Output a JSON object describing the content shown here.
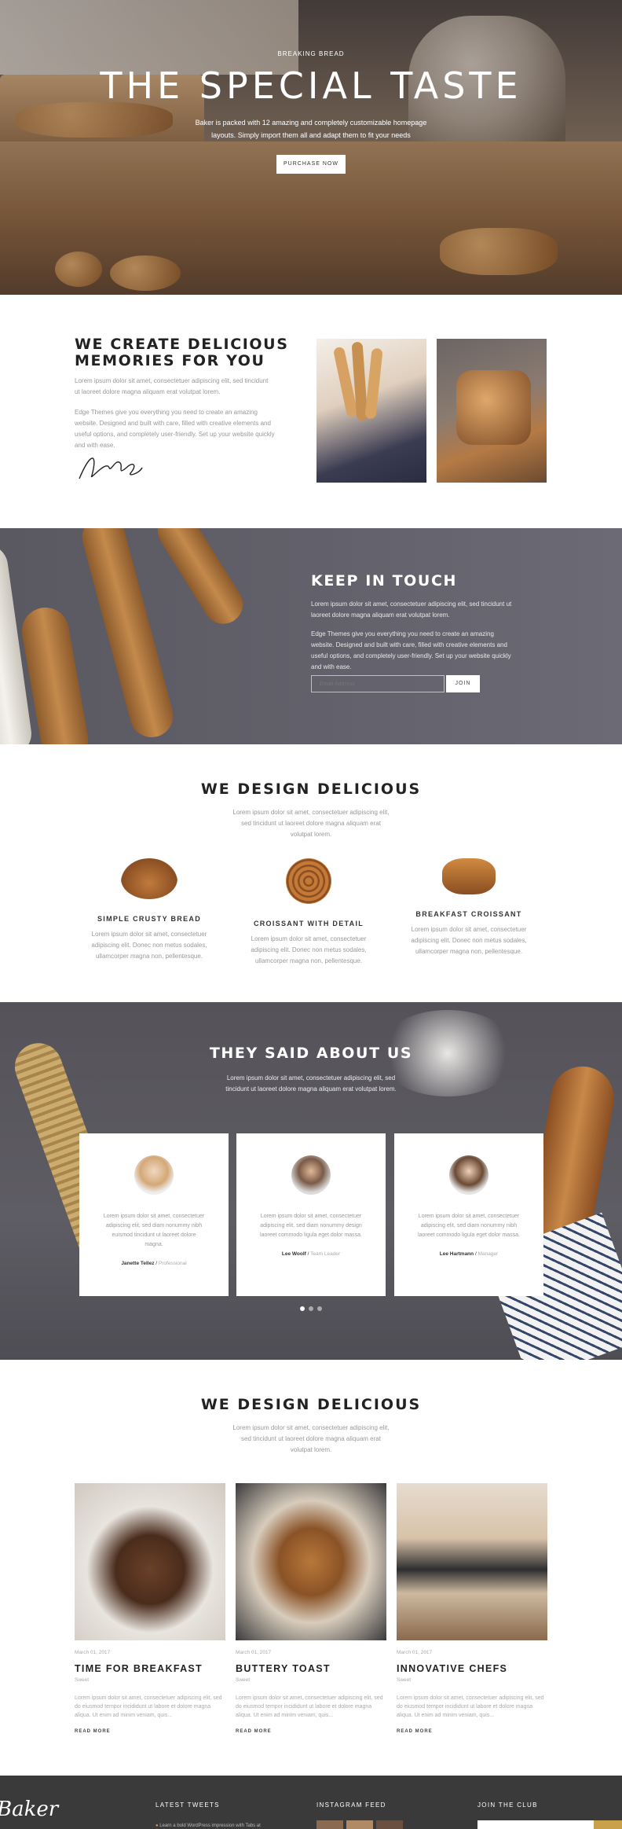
{
  "hero": {
    "eyebrow": "BREAKING BREAD",
    "title": "THE SPECIAL TASTE",
    "subtitle": "Baker is packed with 12 amazing and completely customizable homepage layouts. Simply import them all and adapt them to fit your needs",
    "button": "PURCHASE NOW"
  },
  "about": {
    "title": "WE CREATE DELICIOUS MEMORIES FOR YOU",
    "text1": "Lorem ipsum dolor sit amet, consectetuer adipiscing elit, sed tincidunt ut laoreet dolore magna aliquam erat volutpat lorem.",
    "text2": "Edge Themes give you everything you need to create an amazing website. Designed and built with care, filled with creative elements and useful options, and completely user-friendly. Set up your website quickly and with ease."
  },
  "touch": {
    "title": "KEEP IN TOUCH",
    "text1": "Lorem ipsum dolor sit amet, consectetuer adipiscing elit, sed tincidunt ut laoreet dolore magna aliquam erat volutpat lorem.",
    "text2": "Edge Themes give you everything you need to create an amazing website. Designed and built with care, filled with creative elements and useful options, and completely user-friendly. Set up your website quickly and with ease.",
    "email_placeholder": "Email Address",
    "button": "JOIN"
  },
  "design": {
    "title": "WE DESIGN DELICIOUS",
    "subtitle": "Lorem ipsum dolor sit amet, consectetuer adipiscing elit, sed tincidunt ut laoreet dolore magna aliquam erat volutpat lorem.",
    "features": [
      {
        "title": "SIMPLE CRUSTY BREAD",
        "desc": "Lorem ipsum dolor sit amet, consectetuer adipiscing elit. Donec non metus sodales, ullamcorper magna non, pellentesque.",
        "icon": "croissant-icon",
        "color": "#9a5a2c"
      },
      {
        "title": "CROISSANT WITH DETAIL",
        "desc": "Lorem ipsum dolor sit amet, consectetuer adipiscing elit. Donec non metus sodales, ullamcorper magna non, pellentesque.",
        "icon": "cinnamon-roll-icon",
        "color": "#b06a2e"
      },
      {
        "title": "BREAKFAST CROISSANT",
        "desc": "Lorem ipsum dolor sit amet, consectetuer adipiscing elit. Donec non metus sodales, ullamcorper magna non, pellentesque.",
        "icon": "pastry-icon",
        "color": "#b8742e"
      }
    ]
  },
  "testimonials": {
    "title": "THEY SAID ABOUT US",
    "subtitle": "Lorem ipsum dolor sit amet, consectetuer adipiscing elit, sed tincidunt ut laoreet dolore magna aliquam erat volutpat lorem.",
    "items": [
      {
        "quote": "Lorem ipsum dolor sit amet, consectetuer adipiscing elit, sed diam nonummy nibh euismod tincidunt ut laoreet dolore magna.",
        "name": "Janette Tellez",
        "role": "Professional"
      },
      {
        "quote": "Lorem ipsum dolor sit amet, consectetuer adipiscing elit, sed diam nonummy design laoreet commodo ligula eget dolor massa.",
        "name": "Lee Woolf",
        "role": "Team Leader"
      },
      {
        "quote": "Lorem ipsum dolor sit amet, consectetuer adipiscing elit, sed diam nonummy nibh laoreet commodo ligula eget dolor massa.",
        "name": "Lee Hartmann",
        "role": "Manager"
      }
    ]
  },
  "blog": {
    "title": "WE DESIGN DELICIOUS",
    "subtitle": "Lorem ipsum dolor sit amet, consectetuer adipiscing elit, sed tincidunt ut laoreet dolore magna aliquam erat volutpat lorem.",
    "posts": [
      {
        "date": "March 01, 2017",
        "title": "TIME FOR BREAKFAST",
        "category": "Sweet",
        "desc": "Lorem ipsum dolor sit amet, consectetuer adipiscing elit, sed do eiusmod tempor incididunt ut labore et dolore magna aliqua. Ut enim ad minim veniam, quis...",
        "more": "READ MORE"
      },
      {
        "date": "March 01, 2017",
        "title": "BUTTERY TOAST",
        "category": "Sweet",
        "desc": "Lorem ipsum dolor sit amet, consectetuer adipiscing elit, sed do eiusmod tempor incididunt ut labore et dolore magna aliqua. Ut enim ad minim veniam, quis...",
        "more": "READ MORE"
      },
      {
        "date": "March 01, 2017",
        "title": "INNOVATIVE CHEFS",
        "category": "Sweet",
        "desc": "Lorem ipsum dolor sit amet, consectetuer adipiscing elit, sed do eiusmod tempor incididunt ut labore et dolore magna aliqua. Ut enim ad minim veniam, quis...",
        "more": "READ MORE"
      }
    ]
  },
  "footer": {
    "logo": "Baker",
    "tweets_heading": "LATEST TWEETS",
    "tweet": "Learn a bold WordPress impression with Tabs at",
    "instagram_heading": "INSTAGRAM FEED",
    "join_heading": "JOIN THE CLUB"
  }
}
